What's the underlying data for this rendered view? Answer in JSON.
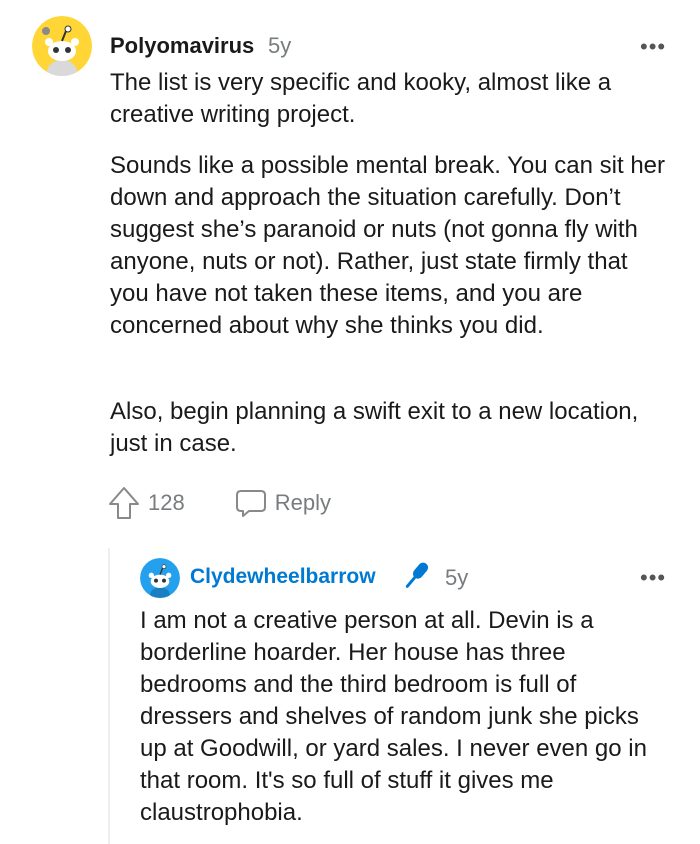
{
  "parent": {
    "username": "Polyomavirus",
    "age": "5y",
    "more_menu": "•••",
    "paragraphs": [
      "The list is very specific and kooky, almost like a creative writing project.",
      "Sounds like a possible mental break. You can sit her down and approach the situation carefully. Don’t suggest she’s paranoid or nuts (not gonna fly with anyone, nuts or not). Rather, just state firmly that you have not taken these items, and you are concerned about why she thinks you did.",
      "Also, begin planning a swift exit to a new location, just in case."
    ],
    "vote_count": "128",
    "reply_label": "Reply",
    "avatar_color": "#ffd635"
  },
  "reply": {
    "username": "Clydewheelbarrow",
    "age": "5y",
    "more_menu": "•••",
    "paragraph": "I am not a creative person at all. Devin is a borderline hoarder. Her house has three bedrooms and the third bedroom is full of dressers and shelves of random junk she picks up at Goodwill, or yard sales. I never even go in that room. It's so full of stuff it gives me claustrophobia.",
    "username_color": "#0079d3",
    "avatar_color": "#24a0ed"
  }
}
